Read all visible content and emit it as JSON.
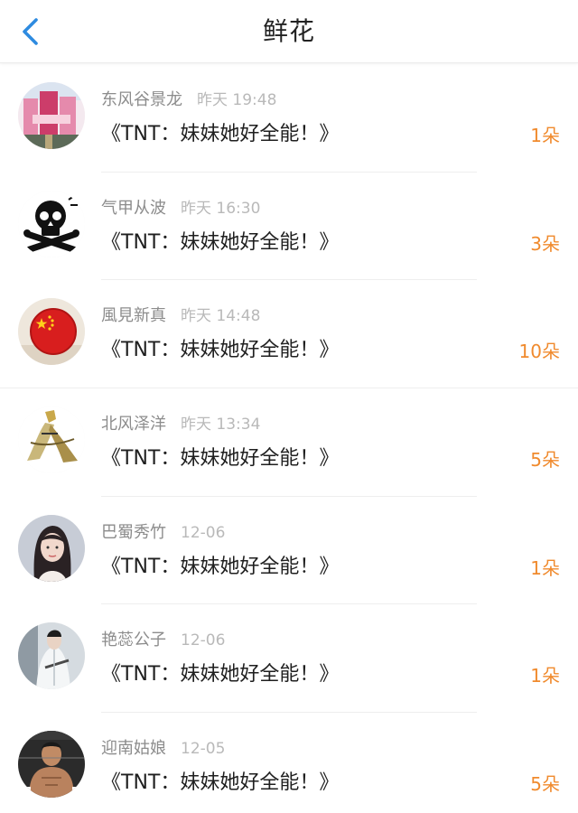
{
  "header": {
    "title": "鲜花",
    "back_icon": "chevron-left-icon",
    "accent": "#2e8be0"
  },
  "items": [
    {
      "username": "东风谷景龙",
      "time": "昨天 19:48",
      "book": "《TNT：妹妹她好全能！》",
      "count": "1朵"
    },
    {
      "username": "气甲从波",
      "time": "昨天 16:30",
      "book": "《TNT：妹妹她好全能！》",
      "count": "3朵"
    },
    {
      "username": "風見新真",
      "time": "昨天 14:48",
      "book": "《TNT：妹妹她好全能！》",
      "count": "10朵"
    },
    {
      "username": "北风泽洋",
      "time": "昨天 13:34",
      "book": "《TNT：妹妹她好全能！》",
      "count": "5朵"
    },
    {
      "username": "巴蜀秀竹",
      "time": "12-06",
      "book": "《TNT：妹妹她好全能！》",
      "count": "1朵"
    },
    {
      "username": "艳蕊公子",
      "time": "12-06",
      "book": "《TNT：妹妹她好全能！》",
      "count": "1朵"
    },
    {
      "username": "迎南姑娘",
      "time": "12-05",
      "book": "《TNT：妹妹她好全能！》",
      "count": "5朵"
    }
  ],
  "colors": {
    "count": "#f08a2d",
    "username": "#8c8c8c",
    "time": "#b9b9b9",
    "book": "#1f1f1f"
  }
}
